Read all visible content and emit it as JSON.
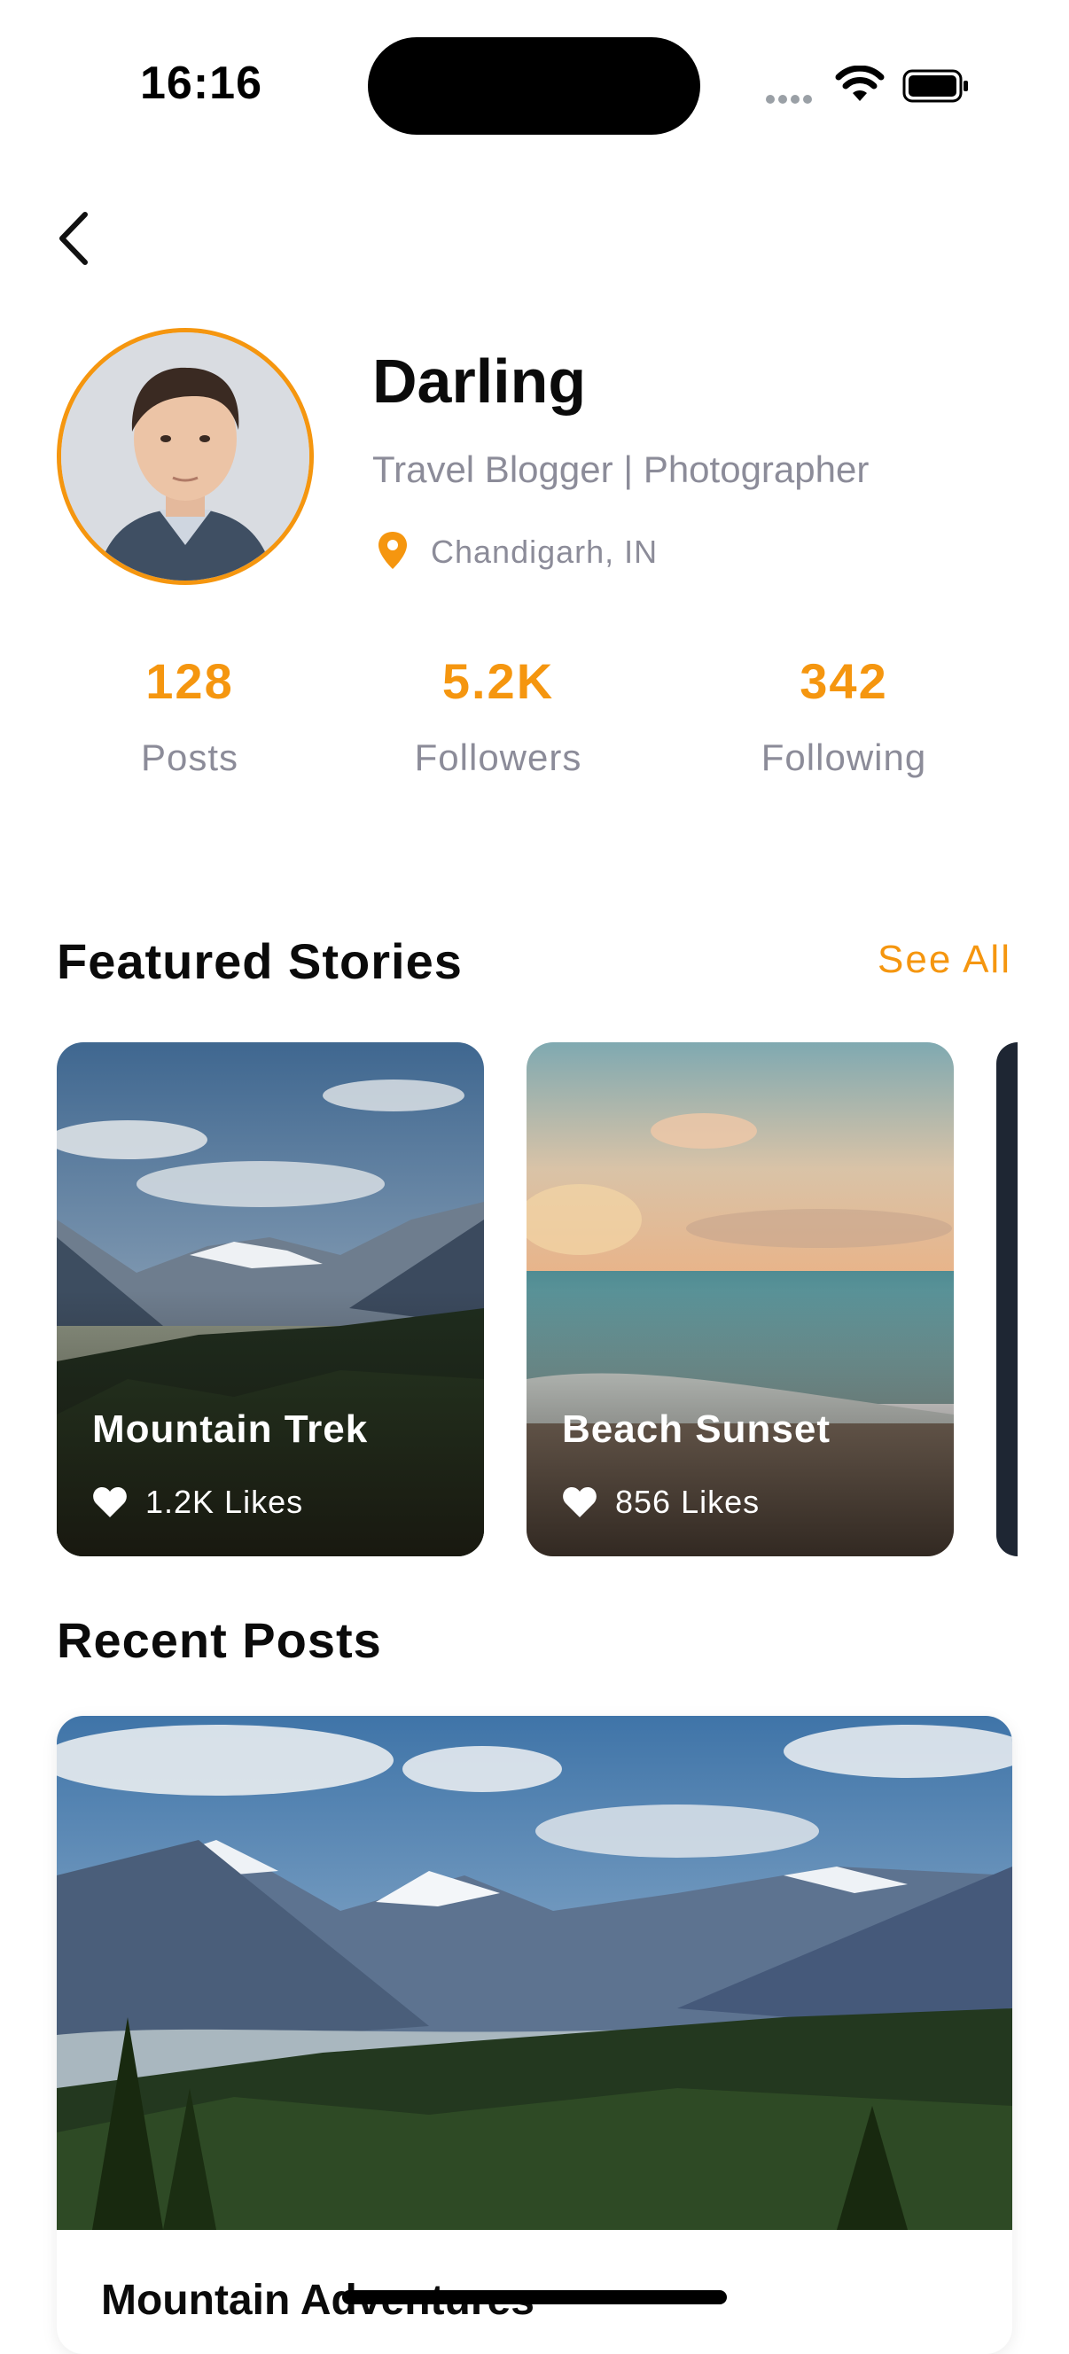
{
  "status_bar": {
    "time": "16:16"
  },
  "profile": {
    "name": "Darling",
    "role": "Travel Blogger | Photographer",
    "location": "Chandigarh, IN"
  },
  "stats": [
    {
      "value": "128",
      "label": "Posts"
    },
    {
      "value": "5.2K",
      "label": "Followers"
    },
    {
      "value": "342",
      "label": "Following"
    }
  ],
  "featured": {
    "title": "Featured Stories",
    "see_all": "See All",
    "stories": [
      {
        "title": "Mountain Trek",
        "likes": "1.2K Likes"
      },
      {
        "title": "Beach Sunset",
        "likes": "856 Likes"
      }
    ]
  },
  "recent": {
    "title": "Recent Posts",
    "posts": [
      {
        "title": "Mountain Adventures"
      }
    ]
  },
  "colors": {
    "accent": "#F5960F",
    "muted": "#8C8C99"
  }
}
